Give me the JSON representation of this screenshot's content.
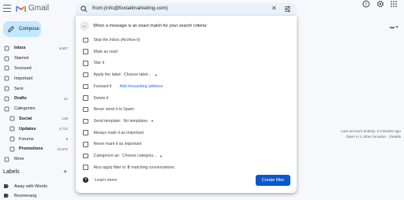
{
  "app": {
    "logo_text": "Gmail"
  },
  "search": {
    "query": "from:(info@foxtailmarketing.com)"
  },
  "compose": {
    "label": "Compose"
  },
  "nav": [
    {
      "label": "Inbox",
      "count": "6,607",
      "icon": "inbox-icon",
      "bold": true
    },
    {
      "label": "Starred",
      "count": "",
      "icon": "star-icon"
    },
    {
      "label": "Snoozed",
      "count": "",
      "icon": "clock-icon"
    },
    {
      "label": "Important",
      "count": "",
      "icon": "important-icon"
    },
    {
      "label": "Sent",
      "count": "",
      "icon": "send-icon"
    },
    {
      "label": "Drafts",
      "count": "41",
      "icon": "draft-icon",
      "bold": true
    },
    {
      "label": "Categories",
      "count": "",
      "icon": "label-icon"
    },
    {
      "label": "Social",
      "count": "148",
      "icon": "social-icon",
      "bold": true,
      "sub": true
    },
    {
      "label": "Updates",
      "count": "4,712",
      "icon": "updates-icon",
      "bold": true,
      "sub": true
    },
    {
      "label": "Forums",
      "count": "9",
      "icon": "forums-icon",
      "sub": true
    },
    {
      "label": "Promotions",
      "count": "12,671",
      "icon": "promotions-icon",
      "bold": true,
      "sub": true
    },
    {
      "label": "More",
      "count": "",
      "icon": "chevron-down-icon"
    }
  ],
  "labels": {
    "heading": "Labels",
    "add": "+",
    "items": [
      "Away with Words",
      "Boomerang"
    ]
  },
  "account": {
    "line1": "Last account activity: 0 minutes ago",
    "line2": "Open in 1 other location · Details"
  },
  "filter": {
    "heading": "When a message is an exact match for your search criteria:",
    "options": [
      {
        "label": "Skip the Inbox (Archive it)"
      },
      {
        "label": "Mark as read"
      },
      {
        "label": "Star it"
      },
      {
        "label": "Apply the label:",
        "dropdown": "Choose label..."
      },
      {
        "label": "Forward it",
        "link": "Add forwarding address"
      },
      {
        "label": "Delete it"
      },
      {
        "label": "Never send it to Spam"
      },
      {
        "label": "Send template:",
        "dropdown": "No templates"
      },
      {
        "label": "Always mark it as important"
      },
      {
        "label": "Never mark it as important"
      },
      {
        "label": "Categorize as:",
        "dropdown": "Choose category..."
      },
      {
        "label_pre": "Also apply filter to",
        "label_bold": "0",
        "label_post": "matching conversations."
      }
    ],
    "learn_more": "Learn more",
    "create_button": "Create filter"
  },
  "colors": {
    "accent": "#0b57d0",
    "compose_bg": "#c2e7ff",
    "search_bg": "#eaf1fb",
    "link": "#1a73e8"
  }
}
